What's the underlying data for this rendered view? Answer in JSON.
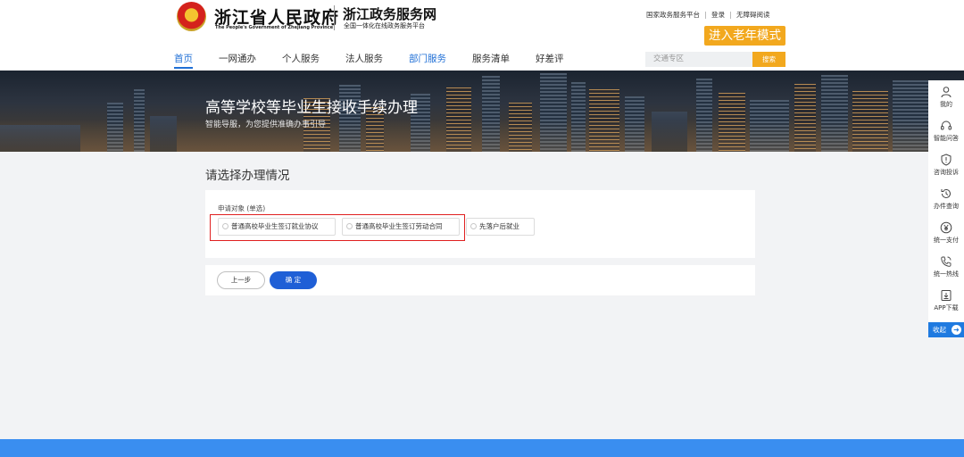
{
  "header": {
    "gov_title": "浙江省人民政府",
    "gov_subtitle": "The People's Government of Zhejiang Province",
    "site_title": "浙江政务服务网",
    "site_subtitle": "全国一体化在线政务服务平台",
    "top_links": [
      "国家政务服务平台",
      "登录",
      "无障碍阅读"
    ],
    "elder_mode": "进入老年模式"
  },
  "nav": {
    "items": [
      "首页",
      "一网通办",
      "个人服务",
      "法人服务",
      "部门服务",
      "服务清单",
      "好差评"
    ],
    "active": "首页"
  },
  "search": {
    "placeholder": "交通专区",
    "button": "搜索"
  },
  "banner": {
    "title": "高等学校等毕业生接收手续办理",
    "subtitle": "智能导服，为您提供准确办事引导"
  },
  "main": {
    "heading": "请选择办理情况",
    "field_label": "申请对象 (单选)",
    "options": [
      "普通高校毕业生签订就业协议",
      "普通高校毕业生签订劳动合同",
      "先落户后就业"
    ],
    "prev_button": "上一步",
    "confirm_button": "确 定"
  },
  "sidebar": {
    "items": [
      {
        "label": "我的",
        "icon": "user-icon"
      },
      {
        "label": "智能问答",
        "icon": "headset-icon"
      },
      {
        "label": "咨询投诉",
        "icon": "shield-icon"
      },
      {
        "label": "办件查询",
        "icon": "history-icon"
      },
      {
        "label": "统一支付",
        "icon": "yen-icon"
      },
      {
        "label": "统一热线",
        "icon": "phone-icon"
      },
      {
        "label": "APP下载",
        "icon": "download-icon"
      }
    ],
    "collapse": "收起"
  },
  "colors": {
    "primary": "#1f5fd6",
    "accent": "#f2a81e",
    "highlight": "#e02020",
    "footer": "#3a8ef0"
  }
}
